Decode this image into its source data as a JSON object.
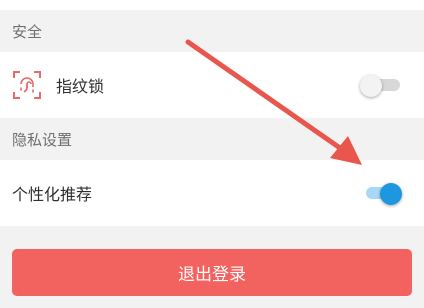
{
  "security_section": {
    "title": "安全"
  },
  "fingerprint_row": {
    "label": "指纹锁",
    "icon": "fingerprint-icon",
    "toggle_on": false
  },
  "privacy_section": {
    "title": "隐私设置"
  },
  "personalization_row": {
    "label": "个性化推荐",
    "toggle_on": true
  },
  "logout": {
    "label": "退出登录"
  },
  "colors": {
    "logout_bg": "#f2625e",
    "annotation_arrow": "#e8564e",
    "toggle_on": "#1e96e0",
    "fingerprint_icon": "#e86a6a"
  }
}
